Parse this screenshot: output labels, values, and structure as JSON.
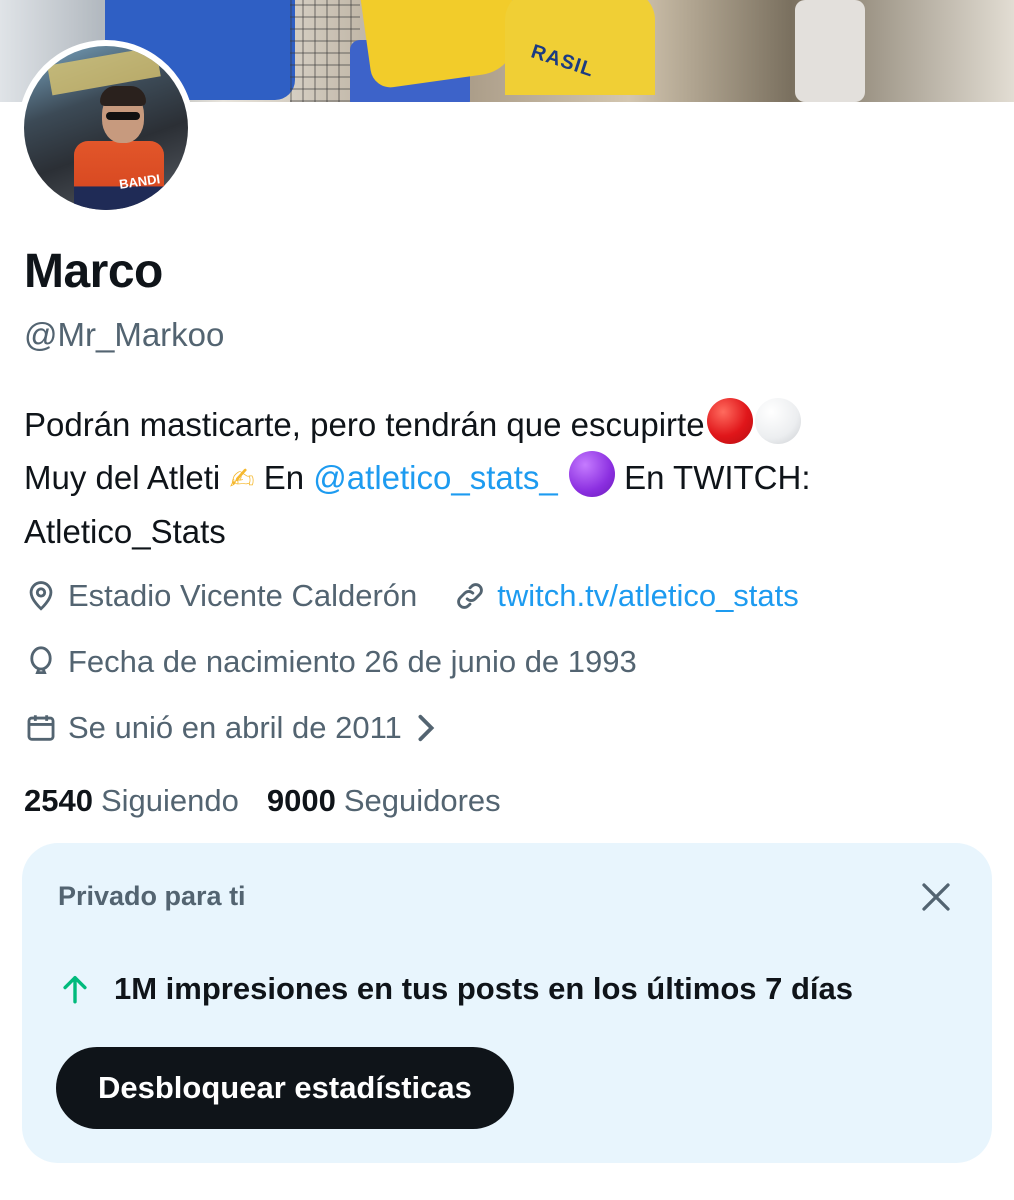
{
  "profile": {
    "name": "Marco",
    "handle": "@Mr_Markoo",
    "bio": {
      "line1_text": "Podrán masticarte, pero tendrán que escupirte",
      "line2_prefix": "Muy del Atleti",
      "line2_en": "En",
      "mention": "@atletico_stats_",
      "line2_suffix": "En TWITCH:",
      "line3": "Atletico_Stats",
      "emojis": [
        "red-circle",
        "white-circle",
        "writing-hand",
        "purple-circle"
      ]
    },
    "location": "Estadio Vicente Calderón",
    "website": "twitch.tv/atletico_stats",
    "birthday": "Fecha de nacimiento 26 de junio de 1993",
    "joined": "Se unió en abril de 2011",
    "following_count": "2540",
    "following_label": "Siguiendo",
    "followers_count": "9000",
    "followers_label": "Seguidores"
  },
  "banner": {
    "visible_text": "RASIL"
  },
  "avatar": {
    "shirt_text": "BANDI"
  },
  "insights_card": {
    "title": "Privado para ti",
    "stat_text": "1M impresiones en tus posts en los últimos 7 días",
    "button_label": "Desbloquear estadísticas",
    "icons": [
      "close-icon",
      "arrow-up-icon"
    ]
  },
  "colors": {
    "link": "#1d9bf0",
    "secondary_text": "#536471",
    "card_bg": "#e8f5fd",
    "trend_up": "#00ba7c",
    "button_bg": "#0f1419"
  }
}
